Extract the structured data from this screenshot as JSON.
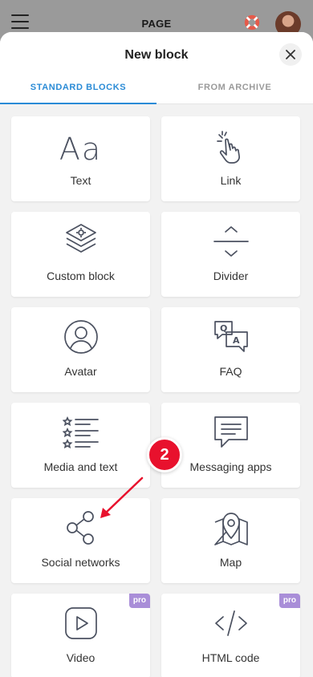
{
  "appbar": {
    "title": "PAGE"
  },
  "sheet": {
    "title": "New block",
    "tabs": [
      {
        "label": "STANDARD BLOCKS",
        "active": true
      },
      {
        "label": "FROM ARCHIVE",
        "active": false
      }
    ]
  },
  "blocks": [
    {
      "label": "Text",
      "icon": "text-icon"
    },
    {
      "label": "Link",
      "icon": "pointer-hand-icon"
    },
    {
      "label": "Custom block",
      "icon": "layers-icon"
    },
    {
      "label": "Divider",
      "icon": "divider-icon"
    },
    {
      "label": "Avatar",
      "icon": "user-circle-icon"
    },
    {
      "label": "FAQ",
      "icon": "qa-bubbles-icon"
    },
    {
      "label": "Media and text",
      "icon": "star-list-icon"
    },
    {
      "label": "Messaging apps",
      "icon": "chat-bubble-icon"
    },
    {
      "label": "Social networks",
      "icon": "share-icon"
    },
    {
      "label": "Map",
      "icon": "map-pin-icon"
    },
    {
      "label": "Video",
      "icon": "play-icon",
      "badge": "pro"
    },
    {
      "label": "HTML code",
      "icon": "code-icon",
      "badge": "pro"
    }
  ],
  "text_icon_glyph": "Aa",
  "annotation": {
    "step": "2"
  },
  "colors": {
    "accent": "#2a8bd6",
    "annotation": "#e8112d",
    "pro_badge": "#a98ed8",
    "icon_stroke": "#4b5160"
  }
}
